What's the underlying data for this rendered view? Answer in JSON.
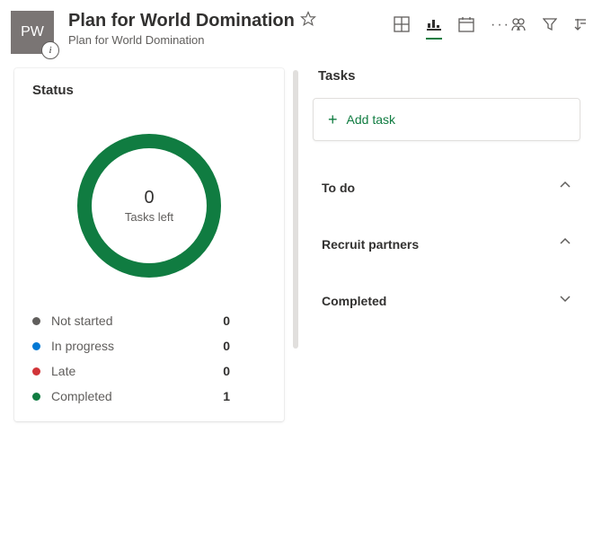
{
  "plan": {
    "initials": "PW",
    "title": "Plan for World Domination",
    "subtitle": "Plan for World Domination"
  },
  "toolbar": {
    "more": "···"
  },
  "status": {
    "card_title": "Status",
    "donut_value": "0",
    "donut_label": "Tasks left",
    "legend": [
      {
        "label": "Not started",
        "count": "0",
        "color": "#605e5c"
      },
      {
        "label": "In progress",
        "count": "0",
        "color": "#0078d4"
      },
      {
        "label": "Late",
        "count": "0",
        "color": "#d13438"
      },
      {
        "label": "Completed",
        "count": "1",
        "color": "#107c41"
      }
    ]
  },
  "tasks": {
    "panel_title": "Tasks",
    "add_label": "Add task",
    "buckets": [
      {
        "title": "To do",
        "chevron": "up"
      },
      {
        "title": "Recruit partners",
        "chevron": "up"
      },
      {
        "title": "Completed",
        "chevron": "down"
      }
    ]
  },
  "chart_data": {
    "type": "pie",
    "title": "Status",
    "center_label": "Tasks left",
    "center_value": 0,
    "series": [
      {
        "name": "Not started",
        "value": 0,
        "color": "#605e5c"
      },
      {
        "name": "In progress",
        "value": 0,
        "color": "#0078d4"
      },
      {
        "name": "Late",
        "value": 0,
        "color": "#d13438"
      },
      {
        "name": "Completed",
        "value": 1,
        "color": "#107c41"
      }
    ]
  }
}
